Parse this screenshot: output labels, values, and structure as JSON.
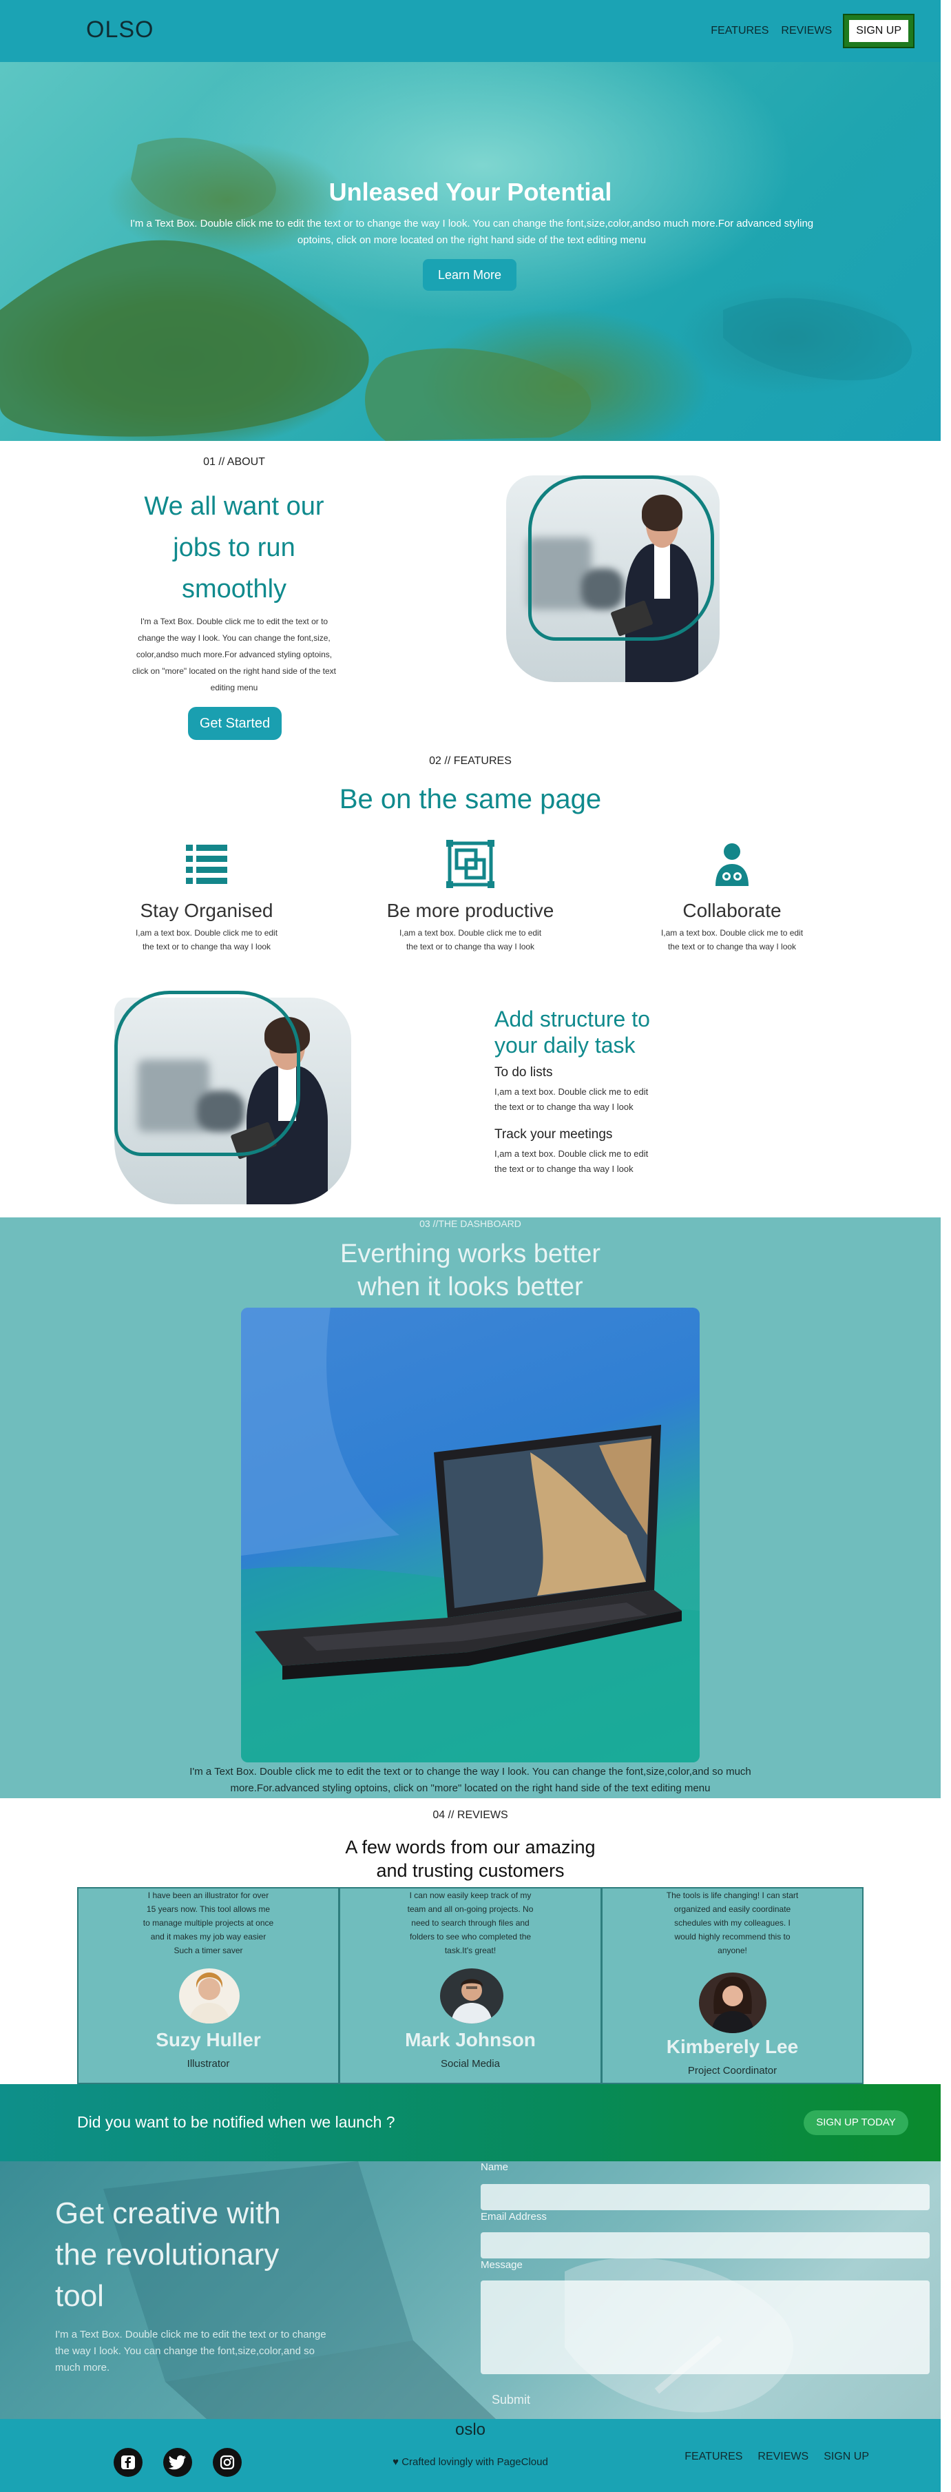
{
  "header": {
    "logo": "OLSO",
    "nav": [
      "FEATURES",
      "REVIEWS"
    ],
    "signup": "SIGN UP"
  },
  "hero": {
    "title": "Unleased Your Potential",
    "text": "I'm a Text Box. Double click me to edit the text or to change the way I look. You can change the font,size,color,andso much more.For advanced styling optoins, click on more located on the right hand side of the text editing menu",
    "button": "Learn More"
  },
  "about": {
    "eyebrow": "01 // ABOUT",
    "heading_lines": [
      "We all want our",
      "jobs to run",
      "smoothly"
    ],
    "text_lines": [
      "I'm a Text Box. Double click me to edit the text or to",
      "change the way I look. You can change the font,size,",
      "color,andso much more.For advanced styling optoins,",
      "click on \"more\" located on the right hand side of the text",
      "editing menu"
    ],
    "button": "Get Started"
  },
  "features": {
    "eyebrow": "02 // FEATURES",
    "heading": "Be on the same page",
    "items": [
      {
        "icon": "list-icon",
        "title": "Stay Organised",
        "text_lines": [
          "I,am a text box. Double click me to edit",
          "the text or to change tha way I look"
        ]
      },
      {
        "icon": "frames-icon",
        "title": "Be more productive",
        "text_lines": [
          "I,am a text box. Double click me to edit",
          "the text or to change tha way I look"
        ]
      },
      {
        "icon": "user-collaborate-icon",
        "title": "Collaborate",
        "text_lines": [
          "I,am a text box. Double click me to edit",
          "the text or to change tha way I look"
        ]
      }
    ]
  },
  "structure": {
    "heading_lines": [
      "Add structure to",
      "your daily task"
    ],
    "blocks": [
      {
        "title": "To do lists",
        "text_lines": [
          "I,am a text box. Double click me to edit",
          "the text or to change tha way I look"
        ]
      },
      {
        "title": "Track your meetings",
        "text_lines": [
          "I,am a text box. Double click me to edit",
          "the text or to change tha way I look"
        ]
      }
    ]
  },
  "dashboard": {
    "eyebrow": "03 //THE DASHBOARD",
    "heading_lines": [
      "Everthing works better",
      "when it looks better"
    ],
    "text": "I'm a Text Box. Double click me to edit the text or to change the way I look. You can change the font,size,color,and so much more.For.advanced styling optoins, click on \"more\" located on the right hand side of the text editing menu"
  },
  "reviews": {
    "eyebrow": "04 // REVIEWS",
    "heading_lines": [
      "A few words from our amazing",
      "and trusting customers"
    ],
    "items": [
      {
        "quote_lines": [
          "I have been an illustrator for over",
          "15 years now. This tool allows me",
          "to manage multiple projects at once",
          "and it makes my job way easier",
          "Such a timer saver"
        ],
        "name": "Suzy Huller",
        "role": "Illustrator"
      },
      {
        "quote_lines": [
          "I can now easily keep track of my",
          "team and all on-going projects. No",
          "need to search through files and",
          "folders to see who completed the",
          "task.It's great!"
        ],
        "name": "Mark Johnson",
        "role": "Social Media"
      },
      {
        "quote_lines": [
          "The tools is life changing! I can start",
          "organized and easily coordinate",
          "schedules with my colleagues. I",
          "would highly recommend this to",
          "anyone!"
        ],
        "name": "Kimberely Lee",
        "role": "Project Coordinator"
      }
    ]
  },
  "notify": {
    "text": "Did you want to be notified when we launch ?",
    "button": "SIGN UP TODAY"
  },
  "contact": {
    "heading_lines": [
      "Get creative with",
      "the revolutionary",
      "tool"
    ],
    "text_lines": [
      "I'm a Text Box. Double click me to edit the text or to change",
      "the way I look. You can change the font,size,color,and so",
      "much more."
    ],
    "labels": {
      "name": "Name",
      "email": "Email Address",
      "message": "Message"
    },
    "submit": "Submit"
  },
  "footer": {
    "brand": "oslo",
    "crafted": "Crafted lovingly with PageCloud",
    "nav": [
      "FEATURES",
      "REVIEWS",
      "SIGN UP"
    ],
    "social": [
      "facebook-icon",
      "twitter-icon",
      "instagram-icon"
    ]
  },
  "colors": {
    "brand": "#1ba3b4",
    "teal_text": "#0f8a8d",
    "dashboard_bg": "#70bdbd",
    "notify_green": "#0a8a2c"
  }
}
